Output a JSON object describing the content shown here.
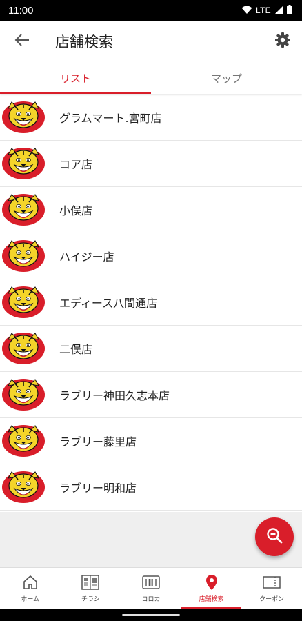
{
  "status_bar": {
    "time": "11:00",
    "network": "LTE",
    "icons": [
      "wifi-icon",
      "signal-icon",
      "battery-icon"
    ]
  },
  "app_bar": {
    "title": "店舗検索",
    "back_icon": "arrow-left-icon",
    "settings_icon": "gear-icon"
  },
  "tabs": [
    {
      "label": "リスト",
      "active": true
    },
    {
      "label": "マップ",
      "active": false
    }
  ],
  "stores": [
    {
      "name": "グラムマート.宮町店",
      "logo": "tiger-logo-icon"
    },
    {
      "name": "コア店",
      "logo": "tiger-logo-icon"
    },
    {
      "name": "小俣店",
      "logo": "tiger-logo-icon"
    },
    {
      "name": "ハイジー店",
      "logo": "tiger-logo-icon"
    },
    {
      "name": "エディース八間通店",
      "logo": "tiger-logo-icon"
    },
    {
      "name": "二俣店",
      "logo": "tiger-logo-icon"
    },
    {
      "name": "ラブリー神田久志本店",
      "logo": "tiger-logo-icon"
    },
    {
      "name": "ラブリー藤里店",
      "logo": "tiger-logo-icon"
    },
    {
      "name": "ラブリー明和店",
      "logo": "tiger-logo-icon"
    }
  ],
  "fab": {
    "icon": "zoom-out-search-icon"
  },
  "bottom_nav": [
    {
      "label": "ホーム",
      "icon": "home-icon",
      "active": false
    },
    {
      "label": "チラシ",
      "icon": "flyer-icon",
      "active": false
    },
    {
      "label": "コロカ",
      "icon": "barcode-card-icon",
      "active": false
    },
    {
      "label": "店舗検索",
      "icon": "location-pin-icon",
      "active": true
    },
    {
      "label": "クーポン",
      "icon": "coupon-icon",
      "active": false
    }
  ],
  "colors": {
    "accent": "#d91e2a",
    "logo_yellow": "#f4d42a",
    "background_gray": "#efefef"
  }
}
